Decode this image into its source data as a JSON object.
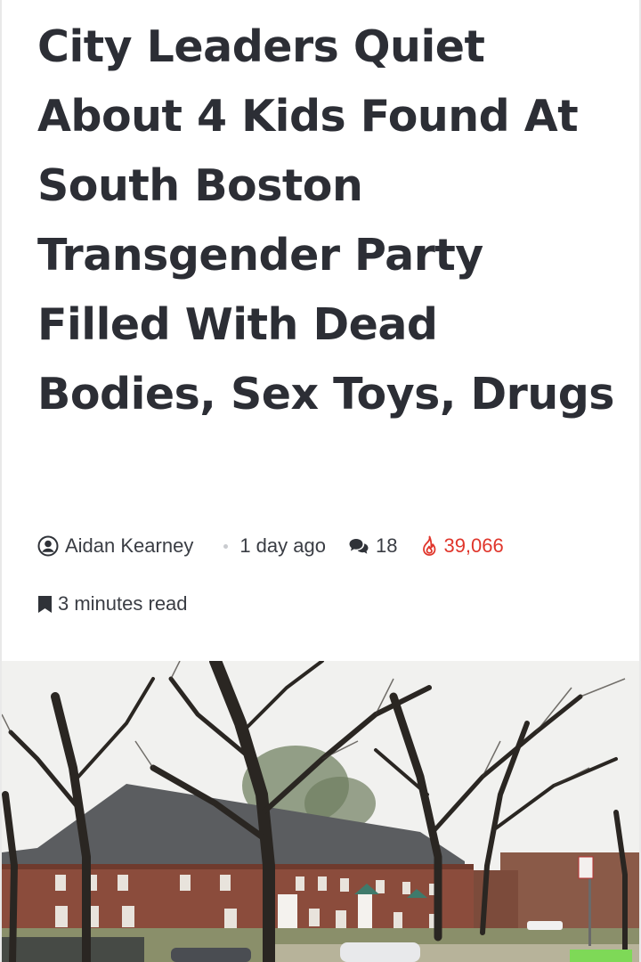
{
  "article": {
    "title": "City Leaders Quiet About 4 Kids Found At South Boston Transgender Party Filled With Dead Bodies, Sex Toys, Drugs",
    "author": "Aidan Kearney",
    "posted": "1 day ago",
    "comments": "18",
    "views": "39,066",
    "read_time": "3 minutes read"
  },
  "icons": {
    "author": "user-circle-icon",
    "comments": "comments-icon",
    "views": "fire-icon",
    "read_time": "bookmark-icon"
  },
  "colors": {
    "title": "#2c2e35",
    "meta_text": "#3a3d44",
    "views_accent": "#e0352b",
    "badge_green": "#7ed957"
  }
}
